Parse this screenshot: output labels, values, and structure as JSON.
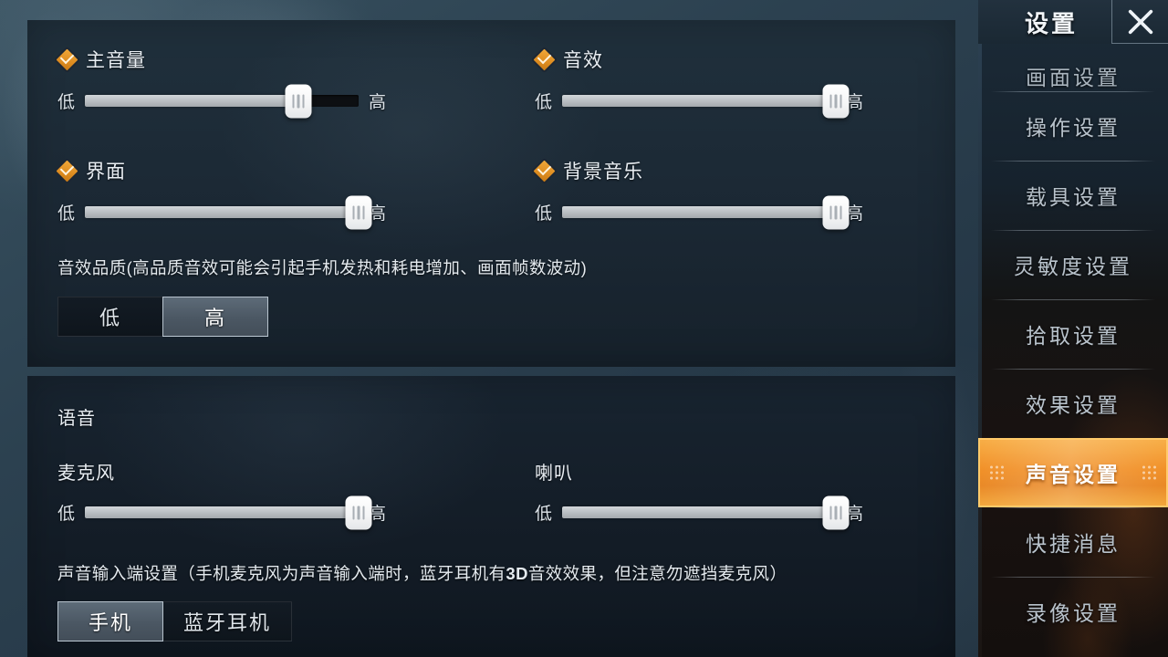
{
  "panels": {
    "audio": {
      "options": [
        {
          "name": "master-volume",
          "label": "主音量",
          "low": "低",
          "high": "高",
          "value": 78
        },
        {
          "name": "sound-effects",
          "label": "音效",
          "low": "低",
          "high": "高",
          "value": 100
        },
        {
          "name": "interface",
          "label": "界面",
          "low": "低",
          "high": "高",
          "value": 100
        },
        {
          "name": "background-music",
          "label": "背景音乐",
          "low": "低",
          "high": "高",
          "value": 100
        }
      ],
      "quality": {
        "note": "音效品质(高品质音效可能会引起手机发热和耗电增加、画面帧数波动)",
        "options": [
          "低",
          "高"
        ],
        "selected": "高"
      }
    },
    "voice": {
      "title": "语音",
      "sliders": [
        {
          "name": "microphone",
          "label": "麦克风",
          "low": "低",
          "high": "高",
          "value": 100
        },
        {
          "name": "speaker",
          "label": "喇叭",
          "low": "低",
          "high": "高",
          "value": 100
        }
      ],
      "input_device": {
        "note_part1": "声音输入端设置（手机麦克风为声音输入端时，蓝牙耳机有",
        "note_bold": "3D",
        "note_part2": "音效效果，但注意勿遮挡麦克风）",
        "options": [
          "手机",
          "蓝牙耳机"
        ],
        "selected": "手机"
      }
    }
  },
  "sidebar": {
    "title": "设置",
    "close_icon": "close-icon",
    "items": [
      {
        "label": "画面设置",
        "selected": false
      },
      {
        "label": "操作设置",
        "selected": false
      },
      {
        "label": "载具设置",
        "selected": false
      },
      {
        "label": "灵敏度设置",
        "selected": false
      },
      {
        "label": "拾取设置",
        "selected": false
      },
      {
        "label": "效果设置",
        "selected": false
      },
      {
        "label": "声音设置",
        "selected": true
      },
      {
        "label": "快捷消息",
        "selected": false
      },
      {
        "label": "录像设置",
        "selected": false
      }
    ]
  },
  "colors": {
    "accent_orange": "#f08a1c",
    "panel_dark": "#1b2834",
    "text_primary": "#e9eef3"
  }
}
